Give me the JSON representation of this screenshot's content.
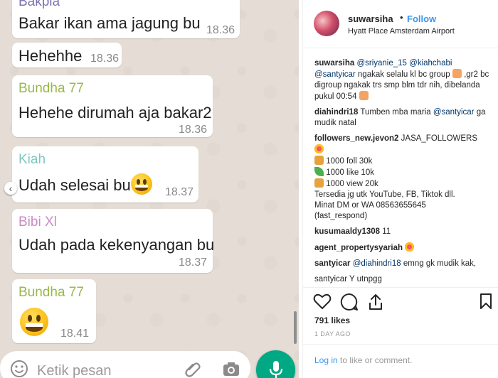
{
  "chat": {
    "messages": [
      {
        "sender": "Bakpia",
        "sender_color": "#7e6fb2",
        "text": "Bakar ikan ama jagung bu",
        "time": "18.36"
      },
      {
        "sender": "",
        "text": "Hehehhe",
        "time": "18.36"
      },
      {
        "sender": "Bundha 77",
        "sender_color": "#98b94a",
        "text": "Hehehe dirumah aja bakar2",
        "time": "18.36"
      },
      {
        "sender": "Kiah",
        "sender_color": "#7fc7c0",
        "text": "Udah selesai bu",
        "time": "18.37",
        "emoji": "grinning-face"
      },
      {
        "sender": "Bibi Xl",
        "sender_color": "#c98bc4",
        "text": "Udah pada kekenyangan bu",
        "time": "18.37"
      },
      {
        "sender": "Bundha 77",
        "sender_color": "#98b94a",
        "text": "",
        "time": "18.41",
        "emoji": "grinning-face"
      }
    ],
    "input_placeholder": "Ketik pesan",
    "nav_glyph": "‹",
    "accent_color": "#00a884"
  },
  "instagram": {
    "username": "suwarsiha",
    "dot": "•",
    "follow_label": "Follow",
    "location": "Hyatt Place Amsterdam Airport",
    "comments": [
      {
        "user": "suwarsiha",
        "mention1": "@sriyanie_15",
        "mention2": "@kiahchabi",
        "mention3": "@santyicar",
        "text1": " ngakak selalu kl bc group ",
        "text2": ",gr2 bc digroup ngakak trs smp blm tdr nih, dibelanda pukul 00:54 "
      },
      {
        "user": "diahindri18",
        "text": " Tumben mba maria ",
        "mention": "@santyicar",
        "text2": " ga mudik natal"
      },
      {
        "user": "followers_new.jevon2",
        "text": " JASA_FOLLOWERS",
        "lines": [
          "1000 foll 30k",
          "1000 like 10k",
          "1000 view 20k",
          "Tersedia jg utk YouTube, FB, Tiktok dll.",
          "Minat DM or WA 08563655645",
          "(fast_respond)"
        ]
      },
      {
        "user": "kusumaaldy1308",
        "text": " 11"
      },
      {
        "user": "agent_propertysyariah",
        "text": " "
      },
      {
        "user": "santyicar",
        "mention": "@diahindri18",
        "text": " emng gk mudik kak,"
      }
    ],
    "next_comment_user": "santyicar Y utnpgg",
    "likes": "791 likes",
    "age": "1 DAY AGO",
    "login_link": "Log in",
    "login_text": " to like or comment.",
    "link_color": "#3897f0"
  }
}
